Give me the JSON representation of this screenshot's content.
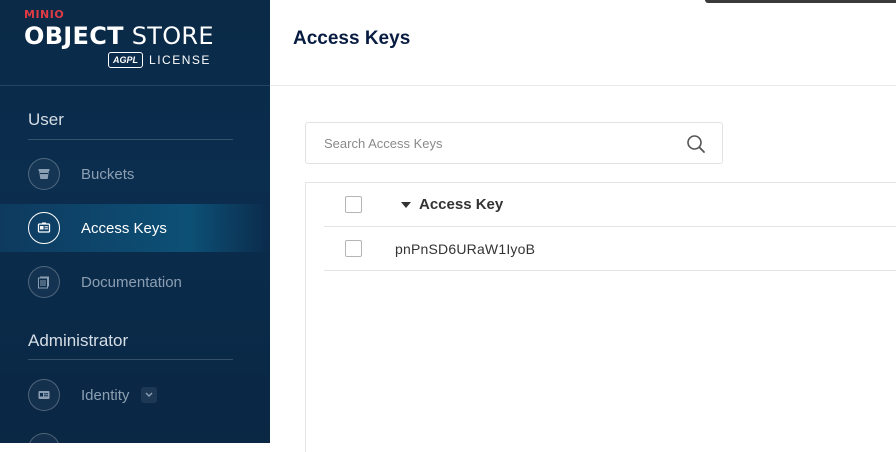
{
  "brand": {
    "minio": "MINIO",
    "product_bold": "OBJECT",
    "product_light": "STORE",
    "agpl": "AGPL",
    "license": "LICENSE"
  },
  "sidebar": {
    "sections": [
      {
        "title": "User",
        "items": [
          {
            "label": "Buckets",
            "icon": "bucket-icon",
            "active": false
          },
          {
            "label": "Access Keys",
            "icon": "key-card-icon",
            "active": true
          },
          {
            "label": "Documentation",
            "icon": "docs-icon",
            "active": false
          }
        ]
      },
      {
        "title": "Administrator",
        "items": [
          {
            "label": "Identity",
            "icon": "identity-icon",
            "active": false,
            "expandable": true
          }
        ]
      }
    ]
  },
  "header": {
    "title": "Access Keys"
  },
  "search": {
    "placeholder": "Search Access Keys",
    "value": ""
  },
  "table": {
    "columns": [
      "Access Key"
    ],
    "sort": "descending",
    "rows": [
      {
        "access_key": "pnPnSD6URaW1IyoB"
      }
    ]
  },
  "colors": {
    "sidebar_bg": "#0b2d4e",
    "brand_red": "#e03a44",
    "title_navy": "#081c42"
  }
}
